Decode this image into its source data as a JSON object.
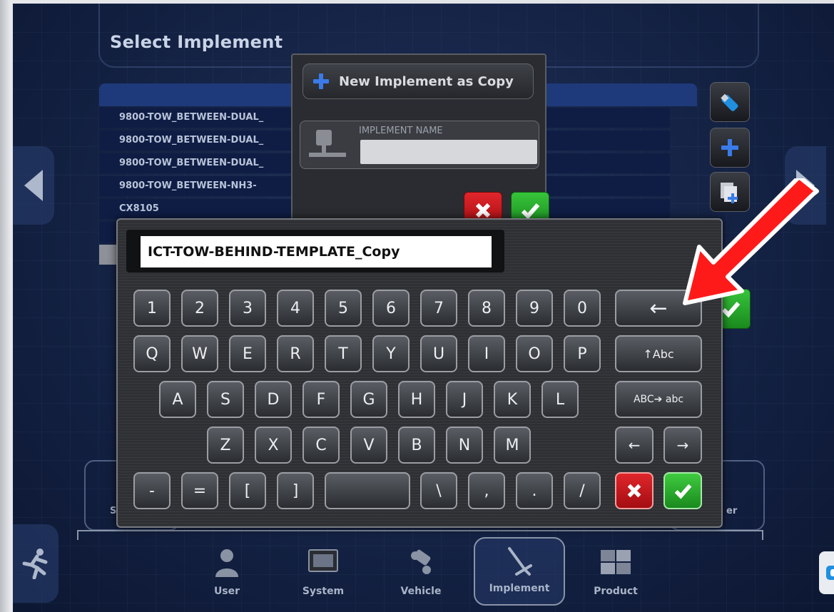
{
  "screen": {
    "title": "Select Implement"
  },
  "implement_list": {
    "rows": [
      "9800-TOW_BETWEEN-DUAL_",
      "9800-TOW_BETWEEN-DUAL_",
      "9800-TOW_BETWEEN-DUAL_",
      "9800-TOW_BETWEEN-NH3-",
      "CX8105"
    ]
  },
  "toolbar": {
    "icons": [
      "usb-icon",
      "add-icon",
      "copy-add-icon"
    ]
  },
  "popup": {
    "title": "New Implement as Copy",
    "field_label": "IMPLEMENT NAME",
    "field_value": ""
  },
  "keyboard": {
    "entry_value": "ICT-TOW-BEHIND-TEMPLATE_Copy",
    "row1": [
      "1",
      "2",
      "3",
      "4",
      "5",
      "6",
      "7",
      "8",
      "9",
      "0"
    ],
    "backspace": "←",
    "row2": [
      "Q",
      "W",
      "E",
      "R",
      "T",
      "Y",
      "U",
      "I",
      "O",
      "P"
    ],
    "shift": "↑Abc",
    "row3": [
      "A",
      "S",
      "D",
      "F",
      "G",
      "H",
      "J",
      "K",
      "L"
    ],
    "case": "ABC➔ abc",
    "row4": [
      "Z",
      "X",
      "C",
      "V",
      "B",
      "N",
      "M"
    ],
    "cursor_left": "←",
    "cursor_right": "→",
    "row5": [
      "-",
      "=",
      "[",
      "]",
      "",
      "\\",
      ",",
      ".",
      "/"
    ]
  },
  "bottom_nav": {
    "items": [
      {
        "label": "User",
        "icon": "user-icon"
      },
      {
        "label": "System",
        "icon": "system-icon"
      },
      {
        "label": "Vehicle",
        "icon": "vehicle-icon"
      },
      {
        "label": "Implement",
        "icon": "implement-icon",
        "active": true
      },
      {
        "label": "Product",
        "icon": "product-icon"
      }
    ],
    "left_partial": "S",
    "right_partial": "er"
  },
  "colors": {
    "accent_blue": "#3a7be8",
    "cancel_red": "#c4161c",
    "ok_green": "#2bb02f",
    "annotation_red": "#ff1a1a"
  }
}
